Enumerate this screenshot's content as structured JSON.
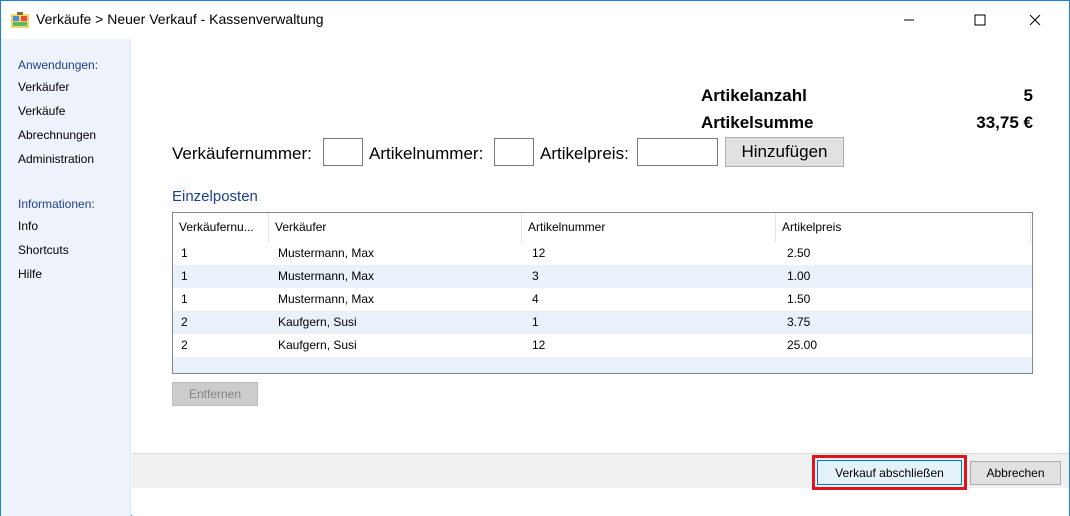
{
  "window": {
    "title": "Verkäufe > Neuer Verkauf - Kassenverwaltung"
  },
  "sidebar": {
    "sections": [
      {
        "heading": "Anwendungen:",
        "items": [
          "Verkäufer",
          "Verkäufe",
          "Abrechnungen",
          "Administration"
        ]
      },
      {
        "heading": "Informationen:",
        "items": [
          "Info",
          "Shortcuts",
          "Hilfe"
        ]
      }
    ]
  },
  "summary": {
    "count_label": "Artikelanzahl",
    "count_value": "5",
    "sum_label": "Artikelsumme",
    "sum_value": "33,75 €"
  },
  "form": {
    "seller_number_label": "Verkäufernummer:",
    "seller_number_value": "",
    "article_number_label": "Artikelnummer:",
    "article_number_value": "",
    "price_label": "Artikelpreis:",
    "price_value": "",
    "add_button": "Hinzufügen"
  },
  "items_section": {
    "title": "Einzelposten",
    "columns": [
      "Verkäufernu...",
      "Verkäufer",
      "Artikelnummer",
      "Artikelpreis"
    ],
    "rows": [
      [
        "1",
        "Mustermann, Max",
        "12",
        "2.50"
      ],
      [
        "1",
        "Mustermann, Max",
        "3",
        "1.00"
      ],
      [
        "1",
        "Mustermann, Max",
        "4",
        "1.50"
      ],
      [
        "2",
        "Kaufgern, Susi",
        "1",
        "3.75"
      ],
      [
        "2",
        "Kaufgern, Susi",
        "12",
        "25.00"
      ]
    ],
    "remove_button": "Entfernen"
  },
  "footer": {
    "finish_button": "Verkauf abschließen",
    "cancel_button": "Abbrechen"
  },
  "colors": {
    "accent_border": "#1883d7",
    "highlight": "#e0141f",
    "sidebar_bg": "#eef3fb",
    "heading_blue": "#1f3f8f"
  }
}
